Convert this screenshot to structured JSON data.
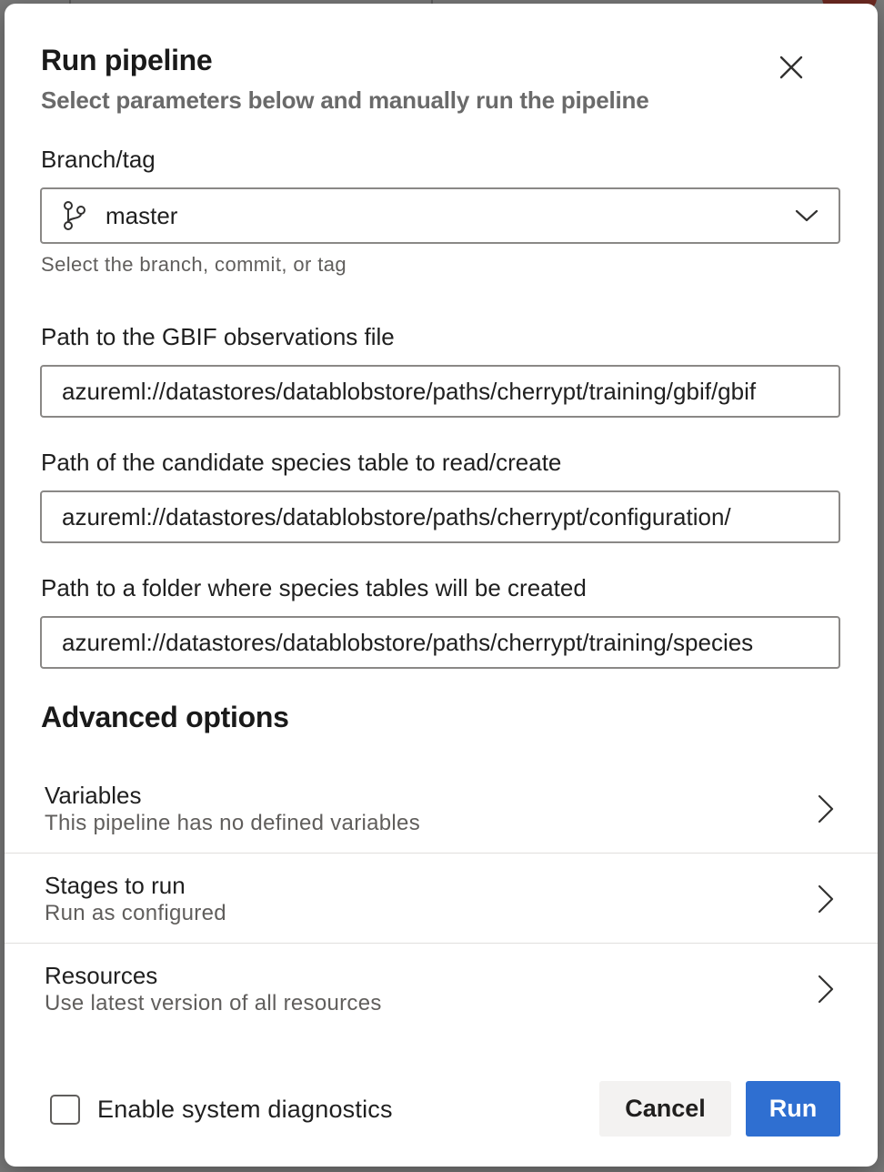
{
  "dialog": {
    "title": "Run pipeline",
    "subtitle": "Select parameters below and manually run the pipeline",
    "close_icon": "close-icon"
  },
  "branch": {
    "label": "Branch/tag",
    "value": "master",
    "icon": "git-branch-icon",
    "helper": "Select the branch, commit, or tag"
  },
  "parameters": [
    {
      "label": "Path to the GBIF observations file",
      "value": "azureml://datastores/datablobstore/paths/cherrypt/training/gbif/gbif"
    },
    {
      "label": "Path of the candidate species table to read/create",
      "value": "azureml://datastores/datablobstore/paths/cherrypt/configuration/"
    },
    {
      "label": "Path to a folder where species tables will be created",
      "value": "azureml://datastores/datablobstore/paths/cherrypt/training/species"
    }
  ],
  "advanced": {
    "heading": "Advanced options",
    "rows": [
      {
        "title": "Variables",
        "subtitle": "This pipeline has no defined variables"
      },
      {
        "title": "Stages to run",
        "subtitle": "Run as configured"
      },
      {
        "title": "Resources",
        "subtitle": "Use latest version of all resources"
      }
    ]
  },
  "footer": {
    "diagnostics_label": "Enable system diagnostics",
    "diagnostics_checked": false,
    "cancel_label": "Cancel",
    "run_label": "Run"
  },
  "colors": {
    "primary": "#2f6fd1",
    "border": "#8a8886",
    "secondary_text": "#605e5c"
  }
}
